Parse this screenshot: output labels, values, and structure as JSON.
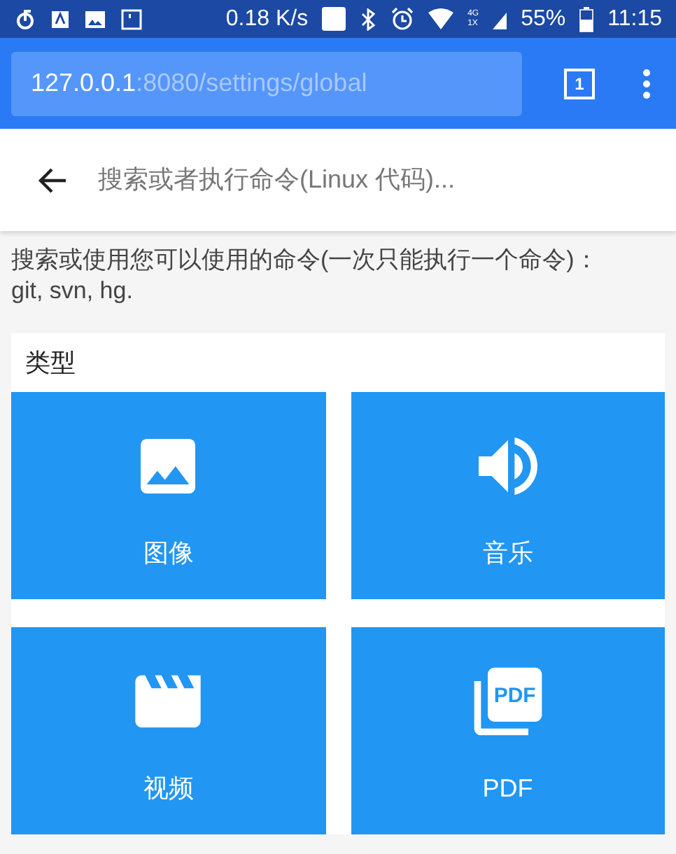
{
  "status_bar": {
    "speed": "0.18 K/s",
    "network_labels": [
      "4G",
      "1X"
    ],
    "battery": "55%",
    "time": "11:15"
  },
  "address_bar": {
    "host": "127.0.0.1",
    "path": ":8080/settings/global",
    "tab_count": "1"
  },
  "search": {
    "placeholder": "搜索或者执行命令(Linux 代码)..."
  },
  "description": "搜索或使用您可以使用的命令(一次只能执行一个命令)：git, svn, hg.",
  "types": {
    "title": "类型",
    "pdf_icon_text": "PDF",
    "items": [
      {
        "kind": "image",
        "label": "图像"
      },
      {
        "kind": "music",
        "label": "音乐"
      },
      {
        "kind": "video",
        "label": "视频"
      },
      {
        "kind": "pdf",
        "label": "PDF"
      }
    ]
  }
}
